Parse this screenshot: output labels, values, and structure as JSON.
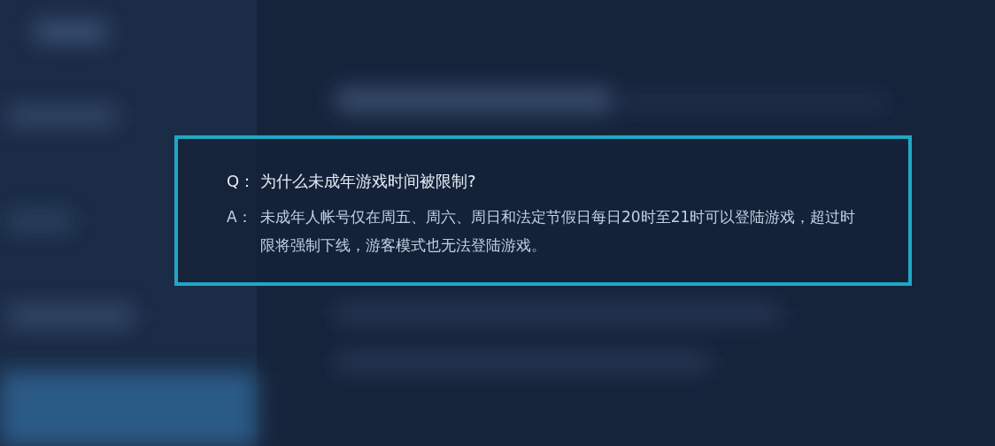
{
  "faq": {
    "question": {
      "label": "Q：",
      "text": "为什么未成年游戏时间被限制?"
    },
    "answer": {
      "label": "A：",
      "text": "未成年人帐号仅在周五、周六、周日和法定节假日每日20时至21时可以登陆游戏，超过时限将强制下线，游客模式也无法登陆游戏。"
    }
  }
}
